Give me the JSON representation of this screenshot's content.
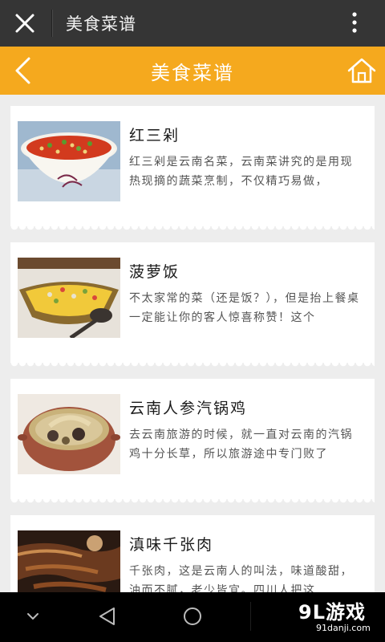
{
  "topbar": {
    "title": "美食菜谱",
    "close_icon": "close-icon",
    "menu_icon": "more-vertical-icon"
  },
  "navbar": {
    "title": "美食菜谱",
    "back_icon": "chevron-left-icon",
    "home_icon": "home-icon",
    "color": "#f5a91e"
  },
  "recipes": [
    {
      "name": "红三剁",
      "desc": "红三剁是云南名菜，云南菜讲究的是用现热现摘的蔬菜烹制，不仅精巧易做，",
      "image": "tomato-soup-image"
    },
    {
      "name": "菠萝饭",
      "desc": "不太家常的菜（还是饭？），但是抬上餐桌一定能让你的客人惊喜称赞！这个",
      "image": "pineapple-rice-image"
    },
    {
      "name": "云南人参汽锅鸡",
      "desc": "去云南旅游的时候，就一直对云南的汽锅鸡十分长草，所以旅游途中专门败了",
      "image": "steam-pot-chicken-image"
    },
    {
      "name": "滇味千张肉",
      "desc": "千张肉，这是云南人的叫法，味道酸甜，油而不腻，老少皆宜。四川人把这",
      "image": "sliced-pork-image"
    }
  ],
  "system_nav": {
    "icons": [
      "chevron-down-icon",
      "back-triangle-icon",
      "home-circle-icon"
    ]
  },
  "watermark": {
    "logo": "9L游戏",
    "site": "91danji.com"
  }
}
